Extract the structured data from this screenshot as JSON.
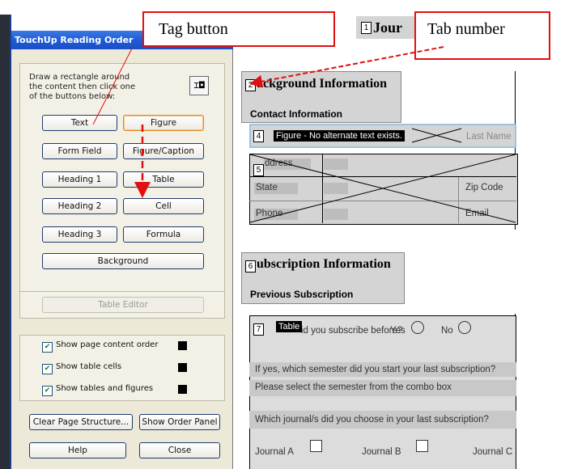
{
  "panel": {
    "title": "TouchUp Reading Order",
    "instructions": "Draw a rectangle around the content then click one of the buttons below:",
    "tag_icon_glyph": "⌶◘",
    "buttons": {
      "text": "Text",
      "figure": "Figure",
      "form_field": "Form Field",
      "figure_caption": "Figure/Caption",
      "heading1": "Heading 1",
      "table": "Table",
      "heading2": "Heading 2",
      "cell": "Cell",
      "heading3": "Heading 3",
      "formula": "Formula",
      "background": "Background",
      "table_editor": "Table Editor",
      "clear_page_structure": "Clear Page Structure...",
      "show_order_panel": "Show Order Panel",
      "help": "Help",
      "close": "Close"
    },
    "checkboxes": [
      {
        "label": "Show page content order",
        "checked": true
      },
      {
        "label": "Show table cells",
        "checked": true
      },
      {
        "label": "Show tables and figures",
        "checked": true
      }
    ]
  },
  "callouts": {
    "tag_button": "Tag button",
    "tab_number": "Tab number"
  },
  "document": {
    "header_partial": "Jour",
    "tab_numbers": {
      "t1": "1",
      "t2": "2",
      "t4": "4",
      "t5": "5",
      "t6": "6",
      "t7": "7"
    },
    "section1": {
      "heading": "ackground Information",
      "subheading": "Contact Information",
      "figure_label": "Figure - No alternate text exists.",
      "fields": {
        "last_name": "Last Name",
        "address": "ddress",
        "state": "State",
        "zip": "Zip Code",
        "phone": "Phone",
        "email": "Email"
      }
    },
    "section2": {
      "heading": "ubscription Information",
      "subheading": "Previous Subscription",
      "table_label": "Table",
      "question1": "id you subscribe before?",
      "yes": "Yes",
      "no": "No",
      "question2": "If yes, which semester did you start your last subscription?",
      "question3": "Please select the semester from the combo box",
      "question4": "Which journal/s did you choose in your last subscription?",
      "journal_a": "Journal A",
      "journal_b": "Journal B",
      "journal_c": "Journal C"
    }
  },
  "colors": {
    "callout_border": "#e01010",
    "title_bar": "#1d5ad8",
    "selected_button_border": "#e08a2c"
  }
}
